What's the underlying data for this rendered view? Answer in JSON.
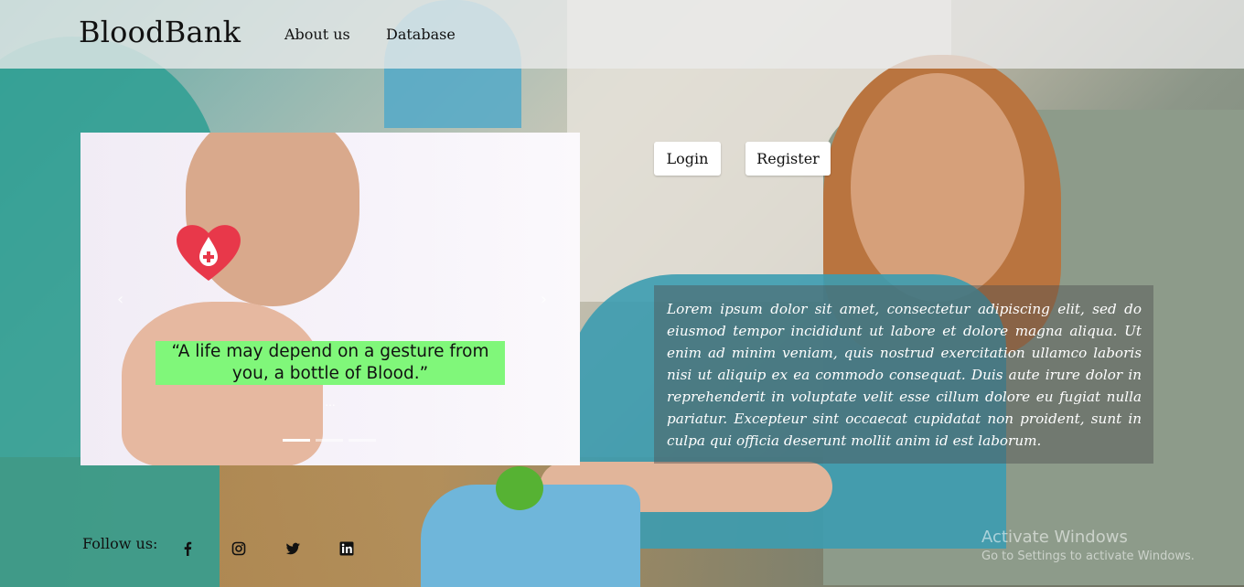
{
  "navbar": {
    "brand": "BloodBank",
    "links": [
      {
        "label": "About us"
      },
      {
        "label": "Database"
      }
    ]
  },
  "carousel": {
    "caption": "“A life may depend on a gesture from you, a bottle of Blood.”",
    "subcaption": "...",
    "active_slide": 1,
    "slide_count": 3
  },
  "auth": {
    "login_label": "Login",
    "register_label": "Register"
  },
  "info": {
    "text": "Lorem ipsum dolor sit amet, consectetur adipiscing elit, sed do eiusmod tempor incididunt ut labore et dolore magna aliqua. Ut enim ad minim veniam, quis nostrud exercitation ullamco laboris nisi ut aliquip ex ea commodo consequat. Duis aute irure dolor in reprehenderit in voluptate velit esse cillum dolore eu fugiat nulla pariatur. Excepteur sint occaecat cupidatat non proident, sunt in culpa qui officia deserunt mollit anim id est laborum."
  },
  "footer": {
    "follow_label": "Follow us:",
    "social_icons": [
      "facebook-icon",
      "instagram-icon",
      "twitter-icon",
      "linkedin-icon"
    ]
  },
  "watermark": {
    "title": "Activate Windows",
    "subtitle": "Go to Settings to activate Windows."
  },
  "colors": {
    "caption_highlight": "#80f77a",
    "navbar_bg": "#ebebeb"
  }
}
